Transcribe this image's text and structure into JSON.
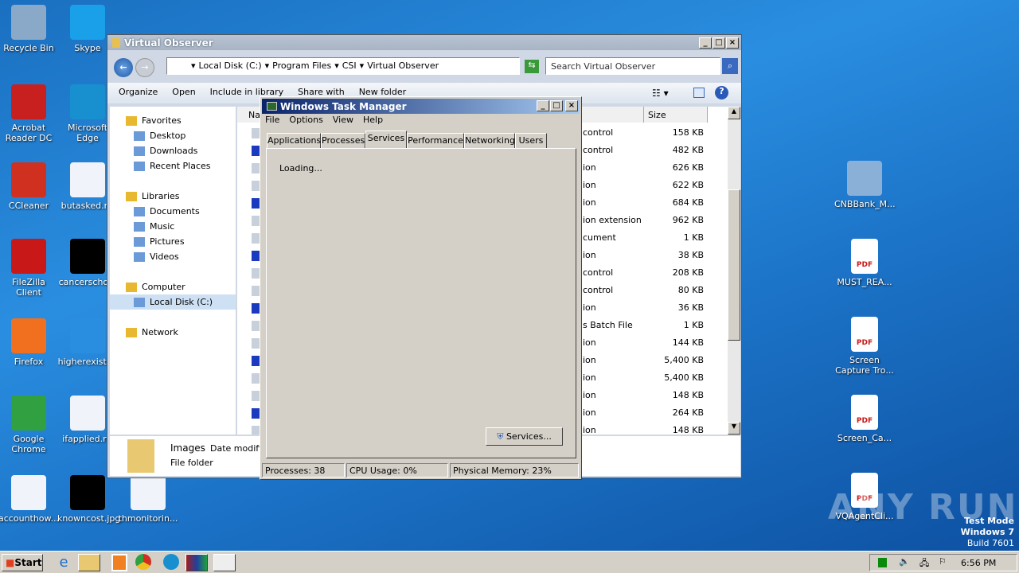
{
  "desktop": {
    "left_icons": [
      {
        "label": "Recycle Bin",
        "icon": "recycle-bin-icon",
        "color": "#8aa8c8"
      },
      {
        "label": "Acrobat Reader DC",
        "icon": "acrobat-icon",
        "color": "#c8201e"
      },
      {
        "label": "CCleaner",
        "icon": "ccleaner-icon",
        "color": "#d03020"
      },
      {
        "label": "FileZilla Client",
        "icon": "filezilla-icon",
        "color": "#c81818"
      },
      {
        "label": "Firefox",
        "icon": "firefox-icon",
        "color": "#f07020"
      },
      {
        "label": "Google Chrome",
        "icon": "chrome-icon",
        "color": "#30a040"
      },
      {
        "label": "accounthow...",
        "icon": "word-doc-icon",
        "color": "#f0f4fa"
      }
    ],
    "second_icons": [
      {
        "label": "Skype",
        "icon": "skype-icon",
        "color": "#1aa0e8"
      },
      {
        "label": "Microsoft Edge",
        "icon": "edge-icon",
        "color": "#1890d0"
      },
      {
        "label": "butasked.rtf",
        "icon": "word-doc-icon",
        "color": "#f0f4fa"
      },
      {
        "label": "cancerscho...",
        "icon": "image-file-icon",
        "color": "#000000"
      },
      {
        "label": "higherexisti...",
        "icon": "image-file-icon",
        "color": "#2a8ee0"
      },
      {
        "label": "ifapplied.rtf",
        "icon": "word-doc-icon",
        "color": "#f0f4fa"
      },
      {
        "label": "knowncost.jpg",
        "icon": "image-file-icon",
        "color": "#000000"
      }
    ],
    "extra_icon": {
      "label": "thmonitorin...",
      "icon": "word-doc-icon"
    },
    "right_icons": [
      {
        "label": "CNBBank_M...",
        "icon": "installer-icon"
      },
      {
        "label": "MUST_REA...",
        "icon": "pdf-icon"
      },
      {
        "label": "Screen Capture Tro...",
        "icon": "pdf-icon"
      },
      {
        "label": "Screen_Ca...",
        "icon": "pdf-icon"
      },
      {
        "label": "VQAgentCli...",
        "icon": "pdf-icon"
      }
    ],
    "pdf_badge": "PDF",
    "watermark": "ANY RUN",
    "test_mode": [
      "Test Mode",
      "Windows 7",
      "Build 7601"
    ]
  },
  "explorer": {
    "title": "Virtual Observer",
    "breadcrumb": [
      "Local Disk (C:)",
      "Program Files",
      "CSI",
      "Virtual Observer"
    ],
    "search_placeholder": "Search Virtual Observer",
    "toolbar": [
      "Organize",
      "Open",
      "Include in library",
      "Share with",
      "New folder"
    ],
    "nav": [
      {
        "label": "Favorites",
        "level": 0,
        "gap": false
      },
      {
        "label": "Desktop",
        "level": 1
      },
      {
        "label": "Downloads",
        "level": 1
      },
      {
        "label": "Recent Places",
        "level": 1
      },
      {
        "label": "Libraries",
        "level": 0,
        "gap": true
      },
      {
        "label": "Documents",
        "level": 1
      },
      {
        "label": "Music",
        "level": 1
      },
      {
        "label": "Pictures",
        "level": 1
      },
      {
        "label": "Videos",
        "level": 1
      },
      {
        "label": "Computer",
        "level": 0,
        "gap": true
      },
      {
        "label": "Local Disk (C:)",
        "level": 1,
        "selected": true
      },
      {
        "label": "Network",
        "level": 0,
        "gap": true
      }
    ],
    "columns": {
      "name": "Na",
      "size": "Size"
    },
    "files": [
      {
        "type": "control",
        "size": "158 KB"
      },
      {
        "type": "control",
        "size": "482 KB"
      },
      {
        "type": "ion",
        "size": "626 KB"
      },
      {
        "type": "ion",
        "size": "622 KB"
      },
      {
        "type": "ion",
        "size": "684 KB"
      },
      {
        "type": "ion extension",
        "size": "962 KB"
      },
      {
        "type": "cument",
        "size": "1 KB"
      },
      {
        "type": "ion",
        "size": "38 KB"
      },
      {
        "type": "control",
        "size": "208 KB"
      },
      {
        "type": "control",
        "size": "80 KB"
      },
      {
        "type": "ion",
        "size": "36 KB"
      },
      {
        "type": "s Batch File",
        "size": "1 KB"
      },
      {
        "type": "ion",
        "size": "144 KB"
      },
      {
        "type": "ion",
        "size": "5,400 KB"
      },
      {
        "type": "ion",
        "size": "5,400 KB"
      },
      {
        "type": "ion",
        "size": "148 KB"
      },
      {
        "type": "ion",
        "size": "264 KB"
      },
      {
        "type": "ion",
        "size": "148 KB"
      }
    ],
    "details": {
      "name": "Images",
      "date_label": "Date modifie",
      "kind": "File folder"
    }
  },
  "taskmgr": {
    "title": "Windows Task Manager",
    "menu": [
      "File",
      "Options",
      "View",
      "Help"
    ],
    "tabs": [
      "Applications",
      "Processes",
      "Services",
      "Performance",
      "Networking",
      "Users"
    ],
    "active_tab": 2,
    "loading": "Loading...",
    "services_button": "Services...",
    "status": {
      "processes": "Processes: 38",
      "cpu": "CPU Usage: 0%",
      "memory": "Physical Memory: 23%"
    }
  },
  "taskbar": {
    "start": "Start",
    "clock": "6:56 PM"
  }
}
